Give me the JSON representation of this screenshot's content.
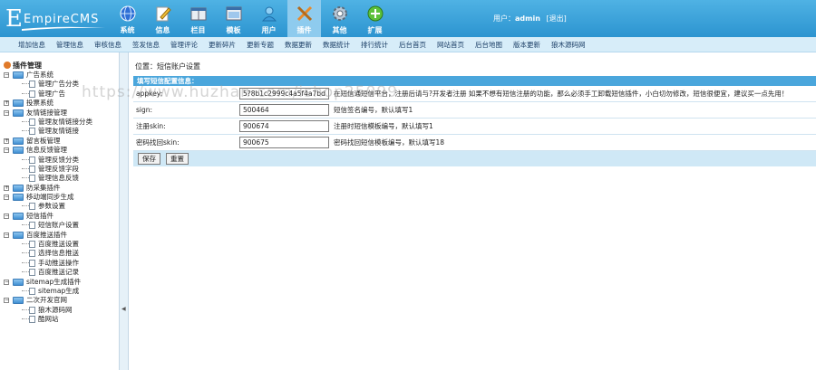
{
  "header": {
    "logo_text": "EmpireCMS",
    "user_prefix": "用户：",
    "username": "admin",
    "logout": "[退出]"
  },
  "topnav": [
    {
      "label": "系统",
      "icon": "system-globe-icon",
      "color": "#2f6fd6"
    },
    {
      "label": "信息",
      "icon": "info-pencil-icon",
      "color": "#f0c23a"
    },
    {
      "label": "栏目",
      "icon": "column-folder-icon",
      "color": "#e9eef3"
    },
    {
      "label": "模板",
      "icon": "template-window-icon",
      "color": "#e9eef3"
    },
    {
      "label": "用户",
      "icon": "user-person-icon",
      "color": "#3a9ad9"
    },
    {
      "label": "插件",
      "icon": "plugin-tools-icon",
      "color": "#e88a2b",
      "active": true
    },
    {
      "label": "其他",
      "icon": "other-gear-icon",
      "color": "#b8c7d6"
    },
    {
      "label": "扩展",
      "icon": "extend-plus-icon",
      "color": "#5cc13a"
    }
  ],
  "subnav": [
    "增加信息",
    "管理信息",
    "审核信息",
    "签发信息",
    "管理评论",
    "更新碎片",
    "更新专题",
    "数据更新",
    "数据统计",
    "排行统计",
    "后台首页",
    "网站首页",
    "后台地图",
    "版本更新",
    "狼木源码网"
  ],
  "sidebar": {
    "root": "插件管理",
    "groups": [
      {
        "label": "广告系统",
        "open": true,
        "children": [
          "管理广告分类",
          "管理广告"
        ]
      },
      {
        "label": "投票系统",
        "open": false,
        "children": []
      },
      {
        "label": "友情链接管理",
        "open": true,
        "children": [
          "管理友情链接分类",
          "管理友情链接"
        ]
      },
      {
        "label": "留言板管理",
        "open": false,
        "children": []
      },
      {
        "label": "信息反馈管理",
        "open": true,
        "children": [
          "管理反馈分类",
          "管理反馈字段",
          "管理信息反馈"
        ]
      },
      {
        "label": "防采集插件",
        "open": false,
        "children": []
      },
      {
        "label": "移动端同步生成",
        "open": true,
        "children": [
          "参数设置"
        ]
      },
      {
        "label": "短信插件",
        "open": true,
        "children": [
          "短信账户设置"
        ]
      },
      {
        "label": "百度推送插件",
        "open": true,
        "children": [
          "百度推送设置",
          "选择信息推送",
          "手动推送操作",
          "百度推送记录"
        ]
      },
      {
        "label": "sitemap生成插件",
        "open": true,
        "children": [
          "sitemap生成"
        ]
      },
      {
        "label": "二次开发官网",
        "open": true,
        "children": [
          "狼木源码网",
          "酷网站"
        ]
      }
    ]
  },
  "main": {
    "breadcrumb": "位置：短信账户设置",
    "panel_title": "填写短信配置信息：",
    "fields": [
      {
        "label": "appkey:",
        "value": "5?8b1c2999c4a5f4a7bd",
        "hint": "在短信通短信平台，注册后请与?开发者注册 如果不想有短信注册的功能，那么必须手工卸载短信插件，小白切勿修改，短信很便宜，建议买一点先用！"
      },
      {
        "label": "sign:",
        "value": "500464",
        "hint": "短信签名编号，默认填写1"
      },
      {
        "label": "注册skin:",
        "value": "900674",
        "hint": "注册时短信模板编号，默认填写1"
      },
      {
        "label": "密码找回skin:",
        "value": "900675",
        "hint": "密码找回短信模板编号，默认填写18"
      }
    ],
    "save_label": "保存",
    "reset_label": "重置"
  },
  "watermark": "https://www.huzhan.com/ishop25099"
}
